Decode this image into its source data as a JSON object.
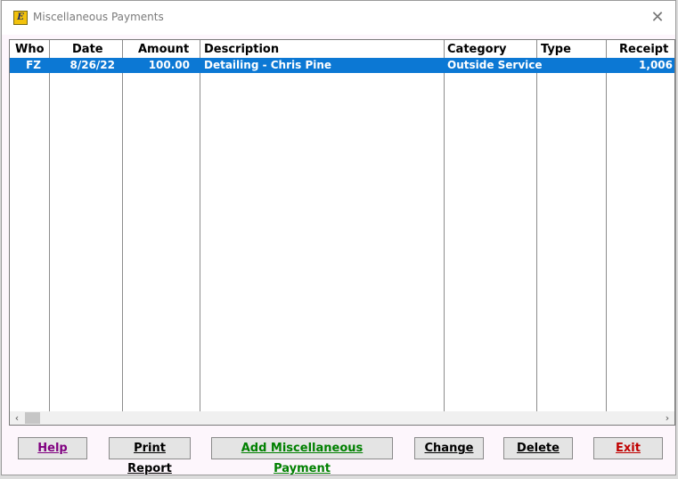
{
  "window": {
    "title": "Miscellaneous Payments",
    "icon": "app-logo-icon",
    "close_glyph": "✕"
  },
  "table": {
    "columns": [
      "Who",
      "Date",
      "Amount",
      "Description",
      "Category",
      "Type",
      "Receipt"
    ],
    "rows": [
      {
        "who": "FZ",
        "date": "8/26/22",
        "amount": "100.00",
        "description": "Detailing - Chris Pine",
        "category": "Outside Service",
        "type": "",
        "receipt": "1,006"
      }
    ],
    "selection_color": "#0c78d4"
  },
  "scrollbar": {
    "left_arrow": "‹",
    "right_arrow": "›"
  },
  "buttons": {
    "help": {
      "label": "Help",
      "color": "#800080"
    },
    "print_report": {
      "label": "Print Report",
      "color": "#000000"
    },
    "add_payment": {
      "label": "Add Miscellaneous Payment",
      "color": "#008000"
    },
    "change": {
      "label": "Change",
      "color": "#000000"
    },
    "delete": {
      "label": "Delete",
      "color": "#000000"
    },
    "exit": {
      "label": "Exit",
      "color": "#c00000"
    }
  }
}
